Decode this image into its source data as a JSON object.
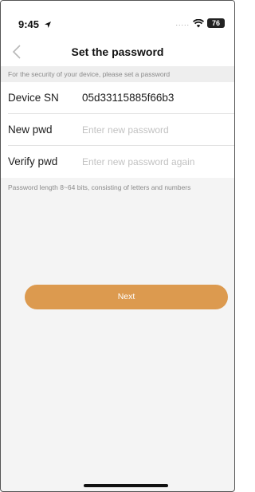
{
  "status_bar": {
    "time": "9:45",
    "signal": ".....",
    "battery": "76"
  },
  "nav": {
    "back_icon": "chevron-left-icon",
    "title": "Set the password"
  },
  "hint_top": "For the security of your device, please set a password",
  "form": {
    "device_sn": {
      "label": "Device SN",
      "value": "05d33115885f66b3"
    },
    "new_pwd": {
      "label": "New pwd",
      "placeholder": "Enter new password",
      "value": ""
    },
    "verify_pwd": {
      "label": "Verify pwd",
      "placeholder": "Enter new password again",
      "value": ""
    }
  },
  "hint_bottom": "Password length 8~64 bits, consisting of letters and numbers",
  "next_button": {
    "label": "Next",
    "color": "#dc9a4f"
  }
}
